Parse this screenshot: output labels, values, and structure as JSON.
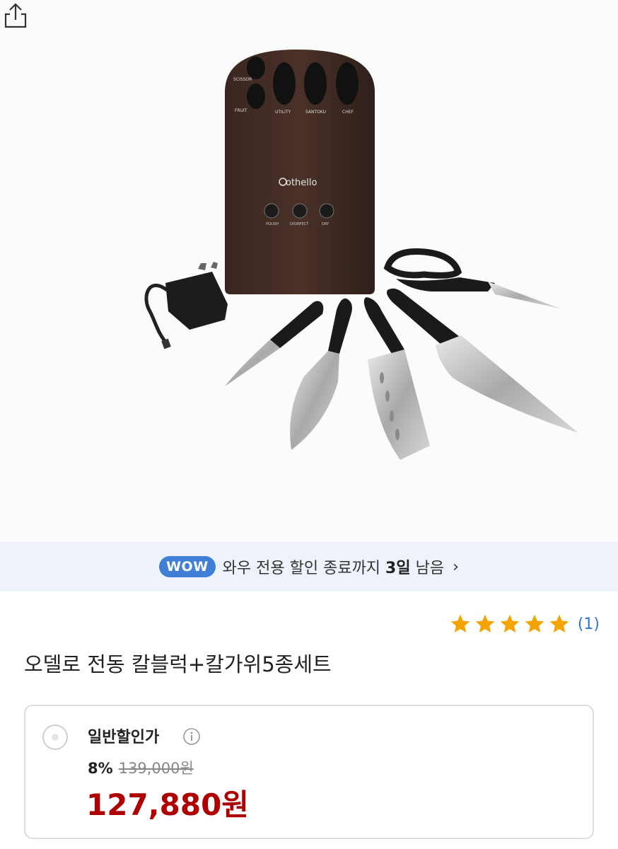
{
  "product_image": {
    "brand": "othello",
    "block_labels": [
      "SCISSOR",
      "FRUIT",
      "UTILITY",
      "SANTOKU",
      "CHEF"
    ],
    "button_labels": [
      "POLISH",
      "DISINFECT",
      "DRY"
    ]
  },
  "banner": {
    "badge": "WOW",
    "text_pre": "와우 전용 할인 종료까지 ",
    "days": "3일",
    "text_post": " 남음",
    "chevron": "›"
  },
  "rating": {
    "stars": 5,
    "count": "(1)",
    "star_color": "#f5a300"
  },
  "product": {
    "title": "오델로 전동 칼블럭+칼가위5종세트"
  },
  "price": {
    "label": "일반할인가",
    "discount": "8%",
    "original": "139,000원",
    "final": "127,880원",
    "final_color": "#ae0000"
  },
  "icons": {
    "share": "share-icon",
    "info": "info-icon",
    "star": "star-icon",
    "chevron": "chevron-right-icon"
  }
}
